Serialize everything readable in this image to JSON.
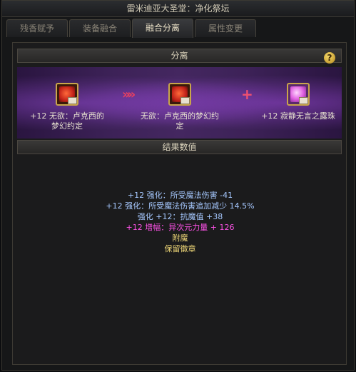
{
  "window": {
    "title": "雷米迪亚大圣堂：净化祭坛"
  },
  "tabs": [
    {
      "label": "残香赋予"
    },
    {
      "label": "装备融合"
    },
    {
      "label": "融合分离"
    },
    {
      "label": "属性变更"
    }
  ],
  "separate": {
    "header": "分离",
    "help": "?",
    "source_item": {
      "label": "+12 无欲：卢克西的梦幻约定"
    },
    "result_item": {
      "label": "无欲：卢克西的梦幻约定"
    },
    "extra_item": {
      "label": "+12 寂静无言之露珠"
    },
    "arrows": "»»",
    "plus": "+"
  },
  "results": {
    "header": "结果数值",
    "lines": [
      "+12 强化：所受魔法伤害 -41",
      "+12 强化：所受魔法伤害追加减少 14.5%",
      "强化 +12：抗魔值 +38",
      "+12 增幅：异次元力量 + 126",
      "附魔",
      "保留徽章"
    ]
  },
  "colors": {
    "stat": "#a6c8ff",
    "amplify": "#ff52e8",
    "note": "#f0d878",
    "accent": "#c9a64a"
  }
}
